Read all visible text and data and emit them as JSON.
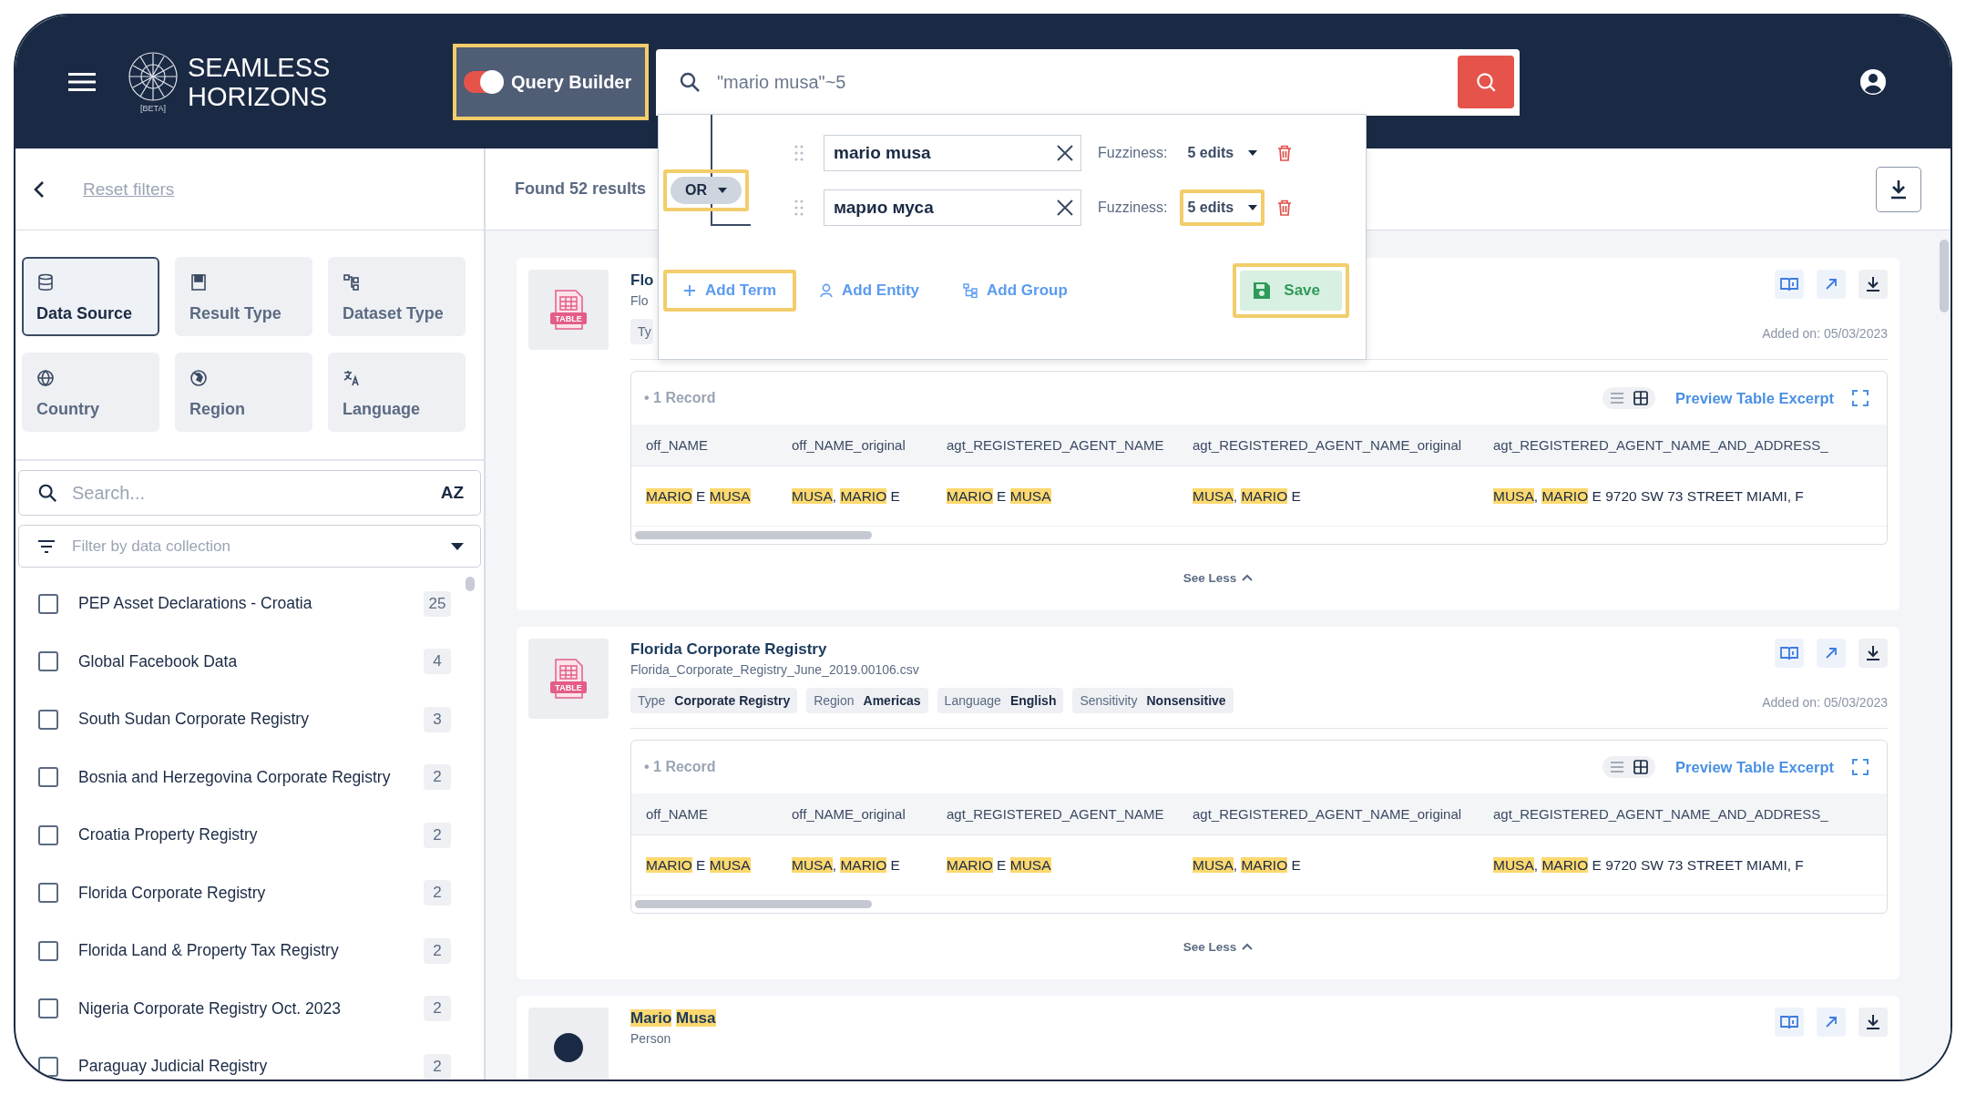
{
  "header": {
    "brand_line1": "SEAMLESS",
    "brand_line2": "HORIZONS",
    "brand_badge": "[BETA]",
    "query_builder": {
      "label": "Query Builder",
      "on": true,
      "highlighted": true
    },
    "search": {
      "value": "\"mario musa\"~5"
    }
  },
  "query_popup": {
    "operator": {
      "label": "OR",
      "highlighted": true
    },
    "terms": [
      {
        "value": "mario musa",
        "fuzziness_label": "Fuzziness:",
        "fuzziness": "5 edits",
        "highlighted": false
      },
      {
        "value": "марио муса",
        "fuzziness_label": "Fuzziness:",
        "fuzziness": "5 edits",
        "highlighted": true
      }
    ],
    "actions": [
      {
        "kind": "term",
        "label": "Add Term",
        "highlighted": true
      },
      {
        "kind": "entity",
        "label": "Add Entity",
        "highlighted": false
      },
      {
        "kind": "group",
        "label": "Add Group",
        "highlighted": false
      }
    ],
    "save": {
      "label": "Save",
      "highlighted": true
    }
  },
  "sidebar": {
    "reset": "Reset filters",
    "filters": [
      {
        "kind": "data_source",
        "label": "Data Source",
        "selected": true
      },
      {
        "kind": "result_type",
        "label": "Result Type",
        "selected": false
      },
      {
        "kind": "dataset_type",
        "label": "Dataset Type",
        "selected": false
      },
      {
        "kind": "country",
        "label": "Country",
        "selected": false
      },
      {
        "kind": "region",
        "label": "Region",
        "selected": false
      },
      {
        "kind": "language",
        "label": "Language",
        "selected": false
      }
    ],
    "search": {
      "placeholder": "Search...",
      "sort_glyph": "AZ"
    },
    "collection_filter": {
      "placeholder": "Filter by data collection"
    },
    "collections": [
      {
        "name": "PEP Asset Declarations - Croatia",
        "count": "25",
        "checked": false
      },
      {
        "name": "Global Facebook Data",
        "count": "4",
        "checked": false
      },
      {
        "name": "South Sudan Corporate Registry",
        "count": "3",
        "checked": false
      },
      {
        "name": "Bosnia and Herzegovina Corporate Registry",
        "count": "2",
        "checked": false
      },
      {
        "name": "Croatia Property Registry",
        "count": "2",
        "checked": false
      },
      {
        "name": "Florida Corporate Registry",
        "count": "2",
        "checked": false
      },
      {
        "name": "Florida Land & Property Tax Registry",
        "count": "2",
        "checked": false
      },
      {
        "name": "Nigeria Corporate Registry Oct. 2023",
        "count": "2",
        "checked": false
      },
      {
        "name": "Paraguay Judicial Registry",
        "count": "2",
        "checked": false
      }
    ]
  },
  "results": {
    "count_text": "Found 52 results",
    "cards": [
      {
        "kind": "table",
        "icon_label": "TABLE",
        "title": [
          {
            "text": "Flo",
            "highlighted": false
          }
        ],
        "subtitle": "Flo",
        "tags": [
          {
            "key": "Ty"
          }
        ],
        "added": "Added on: 05/03/2023",
        "record": {
          "count_text": "• 1 Record",
          "views": [
            {
              "kind": "list",
              "selected": false
            },
            {
              "kind": "grid",
              "selected": true
            }
          ],
          "preview": "Preview Table Excerpt",
          "columns": [
            "off_NAME",
            "off_NAME_original",
            "agt_REGISTERED_AGENT_NAME",
            "agt_REGISTERED_AGENT_NAME_original",
            "agt_REGISTERED_AGENT_NAME_AND_ADDRESS_"
          ],
          "rows": [
            [
              [
                {
                  "text": "MARIO",
                  "highlighted": true
                },
                {
                  "text": " E ",
                  "highlighted": false
                },
                {
                  "text": "MUSA",
                  "highlighted": true
                }
              ],
              [
                {
                  "text": "MUSA",
                  "highlighted": true
                },
                {
                  "text": ", ",
                  "highlighted": false
                },
                {
                  "text": "MARIO",
                  "highlighted": true
                },
                {
                  "text": " E",
                  "highlighted": false
                }
              ],
              [
                {
                  "text": "MARIO",
                  "highlighted": true
                },
                {
                  "text": " E ",
                  "highlighted": false
                },
                {
                  "text": "MUSA",
                  "highlighted": true
                }
              ],
              [
                {
                  "text": "MUSA",
                  "highlighted": true
                },
                {
                  "text": ", ",
                  "highlighted": false
                },
                {
                  "text": "MARIO",
                  "highlighted": true
                },
                {
                  "text": " E",
                  "highlighted": false
                }
              ],
              [
                {
                  "text": "MUSA",
                  "highlighted": true
                },
                {
                  "text": ", ",
                  "highlighted": false
                },
                {
                  "text": "MARIO",
                  "highlighted": true
                },
                {
                  "text": " E 9720 SW 73 STREET MIAMI, F",
                  "highlighted": false
                }
              ]
            ]
          ]
        },
        "see_less": "See Less"
      },
      {
        "kind": "table",
        "icon_label": "TABLE",
        "title": [
          {
            "text": "Florida Corporate Registry",
            "highlighted": false
          }
        ],
        "subtitle": "Florida_Corporate_Registry_June_2019.00106.csv",
        "tags": [
          {
            "key": "Type",
            "value": "Corporate Registry"
          },
          {
            "key": "Region",
            "value": "Americas"
          },
          {
            "key": "Language",
            "value": "English"
          },
          {
            "key": "Sensitivity",
            "value": "Nonsensitive"
          }
        ],
        "added": "Added on: 05/03/2023",
        "record": {
          "count_text": "• 1 Record",
          "views": [
            {
              "kind": "list",
              "selected": false
            },
            {
              "kind": "grid",
              "selected": true
            }
          ],
          "preview": "Preview Table Excerpt",
          "columns": [
            "off_NAME",
            "off_NAME_original",
            "agt_REGISTERED_AGENT_NAME",
            "agt_REGISTERED_AGENT_NAME_original",
            "agt_REGISTERED_AGENT_NAME_AND_ADDRESS_"
          ],
          "rows": [
            [
              [
                {
                  "text": "MARIO",
                  "highlighted": true
                },
                {
                  "text": " E ",
                  "highlighted": false
                },
                {
                  "text": "MUSA",
                  "highlighted": true
                }
              ],
              [
                {
                  "text": "MUSA",
                  "highlighted": true
                },
                {
                  "text": ", ",
                  "highlighted": false
                },
                {
                  "text": "MARIO",
                  "highlighted": true
                },
                {
                  "text": " E",
                  "highlighted": false
                }
              ],
              [
                {
                  "text": "MARIO",
                  "highlighted": true
                },
                {
                  "text": " E ",
                  "highlighted": false
                },
                {
                  "text": "MUSA",
                  "highlighted": true
                }
              ],
              [
                {
                  "text": "MUSA",
                  "highlighted": true
                },
                {
                  "text": ", ",
                  "highlighted": false
                },
                {
                  "text": "MARIO",
                  "highlighted": true
                },
                {
                  "text": " E",
                  "highlighted": false
                }
              ],
              [
                {
                  "text": "MUSA",
                  "highlighted": true
                },
                {
                  "text": ", ",
                  "highlighted": false
                },
                {
                  "text": "MARIO",
                  "highlighted": true
                },
                {
                  "text": " E 9720 SW 73 STREET MIAMI, F",
                  "highlighted": false
                }
              ]
            ]
          ]
        },
        "see_less": "See Less"
      },
      {
        "kind": "person",
        "title": [
          {
            "text": "Mario",
            "highlighted": true
          },
          {
            "text": "Musa",
            "highlighted": true
          }
        ],
        "subtitle": "Person"
      }
    ]
  }
}
